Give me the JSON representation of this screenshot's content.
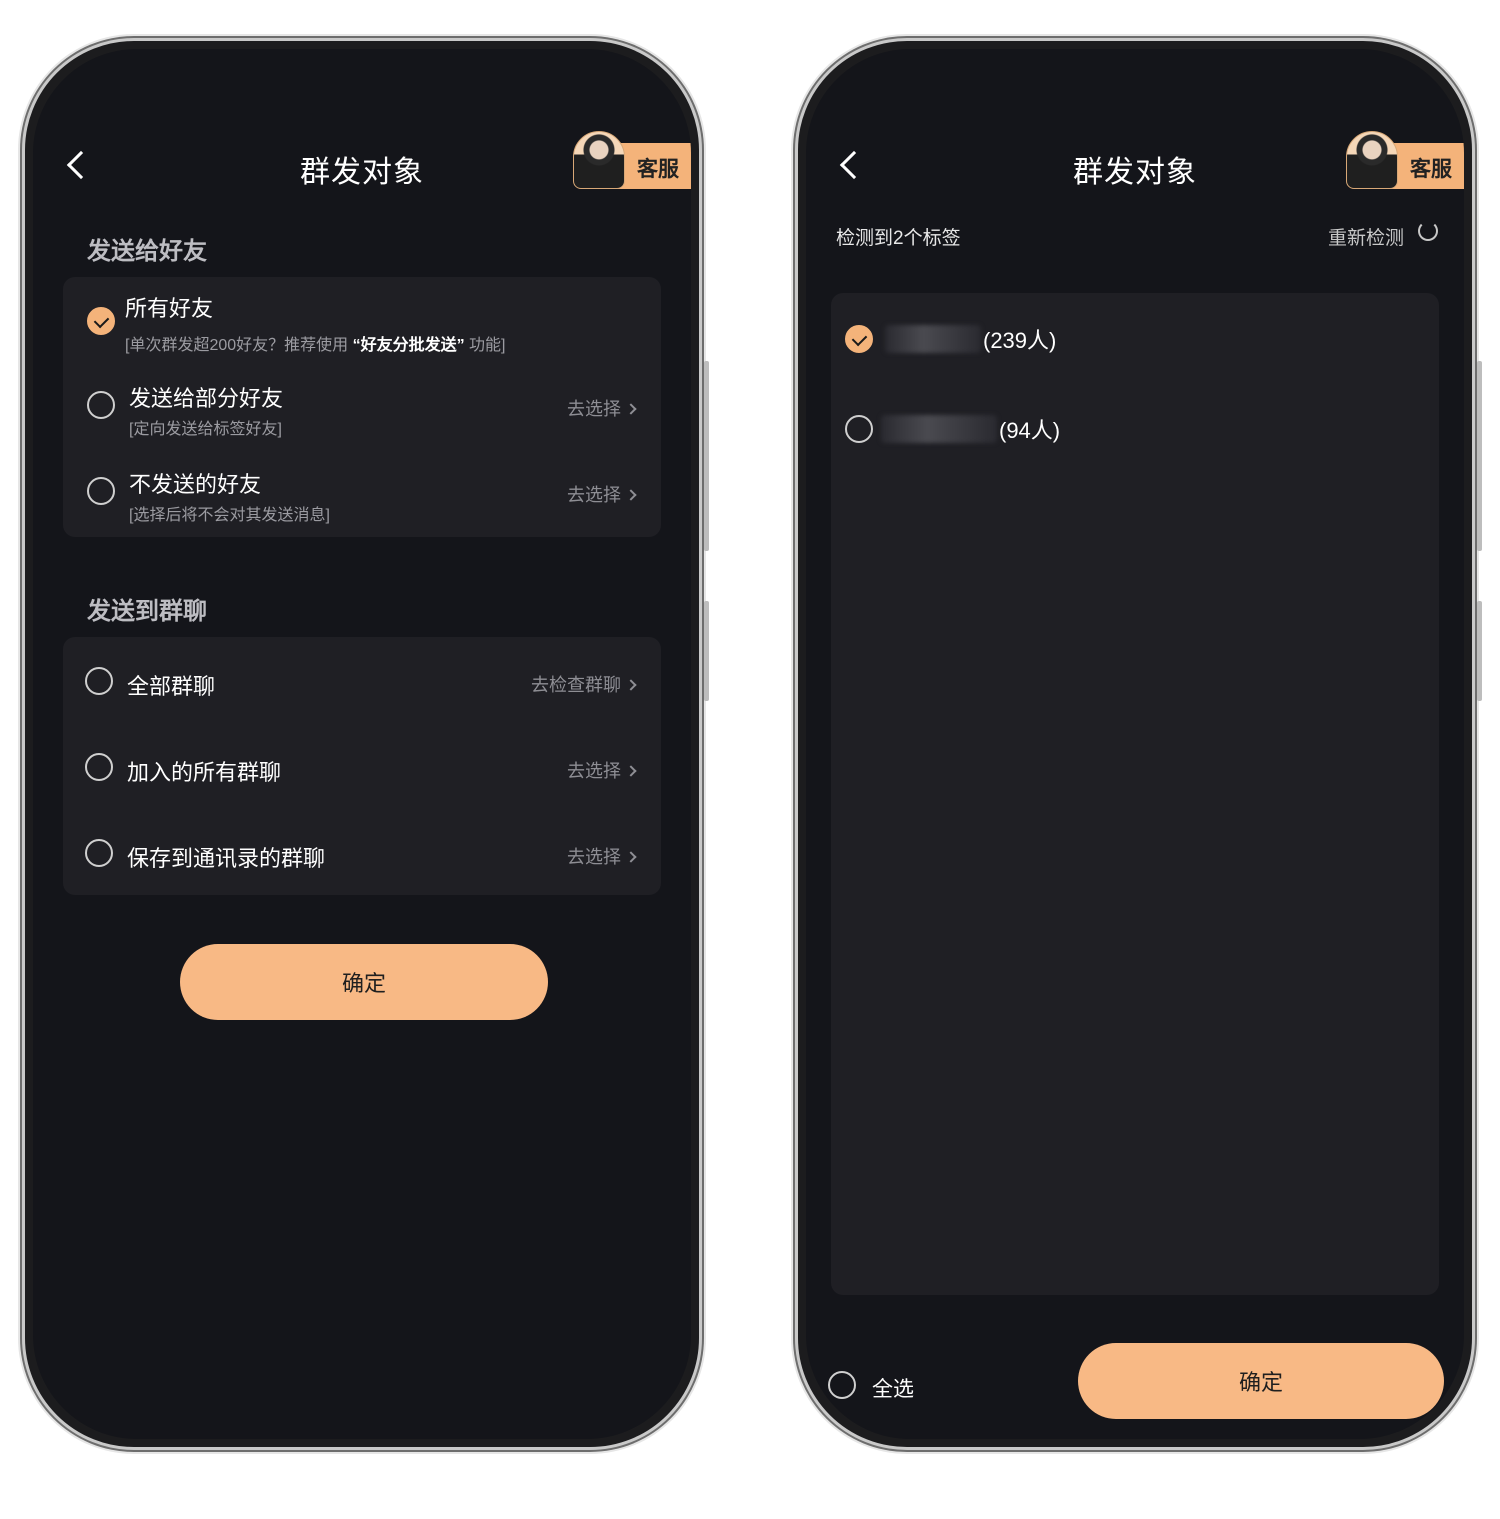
{
  "left": {
    "title": "群发对象",
    "kefu_label": "客服",
    "friends_section": "发送给好友",
    "friend_options": [
      {
        "label": "所有好友",
        "hint_pre": "[单次群发超200好友？推荐使用 ",
        "hint_bold": "“好友分批发送”",
        "hint_post": " 功能]",
        "checked": true
      },
      {
        "label": "发送给部分好友",
        "hint": "[定向发送给标签好友]",
        "action": "去选择",
        "checked": false
      },
      {
        "label": "不发送的好友",
        "hint": "[选择后将不会对其发送消息]",
        "action": "去选择",
        "checked": false
      }
    ],
    "groups_section": "发送到群聊",
    "group_options": [
      {
        "label": "全部群聊",
        "action": "去检查群聊",
        "checked": false
      },
      {
        "label": "加入的所有群聊",
        "action": "去选择",
        "checked": false
      },
      {
        "label": "保存到通讯录的群聊",
        "action": "去选择",
        "checked": false
      }
    ],
    "confirm": "确定"
  },
  "right": {
    "title": "群发对象",
    "kefu_label": "客服",
    "detect_text": "检测到2个标签",
    "redetect": "重新检测",
    "tags": [
      {
        "count": "(239人)",
        "checked": true
      },
      {
        "count": "(94人)",
        "checked": false
      }
    ],
    "select_all": "全选",
    "confirm": "确定"
  },
  "colors": {
    "accent": "#f8b985",
    "background": "#14151a",
    "card": "#1f1f24"
  },
  "icons": [
    "back-icon",
    "avatar",
    "check-icon",
    "chevron-right-icon",
    "refresh-icon"
  ]
}
